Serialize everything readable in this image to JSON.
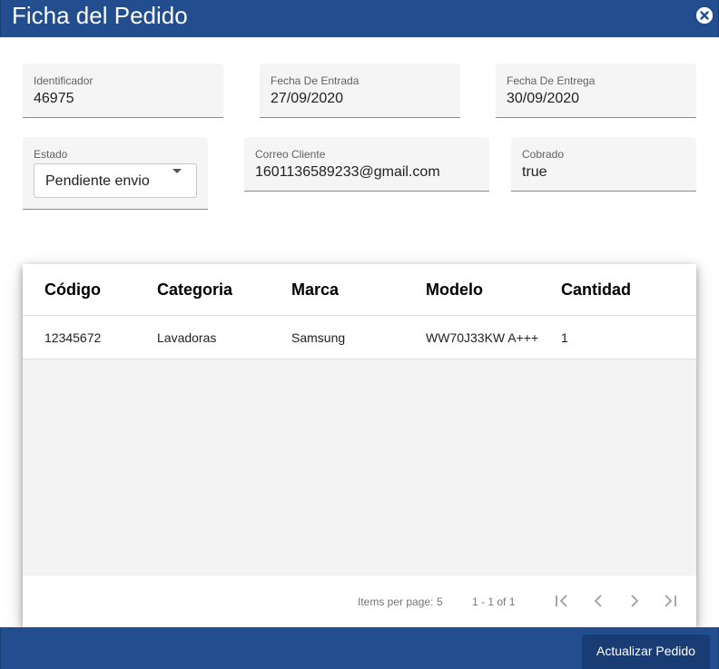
{
  "dialog": {
    "title": "Ficha del Pedido",
    "close_icon": "close-circle-icon"
  },
  "fields": {
    "identificador": {
      "label": "Identificador",
      "value": "46975"
    },
    "fecha_entrada": {
      "label": "Fecha De Entrada",
      "value": "27/09/2020"
    },
    "fecha_entrega": {
      "label": "Fecha De Entrega",
      "value": "30/09/2020"
    },
    "estado": {
      "label": "Estado",
      "value": "Pendiente envio"
    },
    "correo": {
      "label": "Correo Cliente",
      "value": "1601136589233@gmail.com"
    },
    "cobrado": {
      "label": "Cobrado",
      "value": "true"
    }
  },
  "table": {
    "columns": [
      "Código",
      "Categoria",
      "Marca",
      "Modelo",
      "Cantidad"
    ],
    "rows": [
      [
        "12345672",
        "Lavadoras",
        "Samsung",
        "WW70J33KW A+++",
        "1"
      ]
    ]
  },
  "paginator": {
    "items_per_page_label": "Items per page:",
    "page_size": "5",
    "range": "1 - 1 of 1",
    "icons": [
      "first-page-icon",
      "previous-page-icon",
      "next-page-icon",
      "last-page-icon"
    ]
  },
  "footer": {
    "update_label": "Actualizar Pedido"
  },
  "colors": {
    "primary": "#224e8f",
    "button": "#183c73"
  }
}
